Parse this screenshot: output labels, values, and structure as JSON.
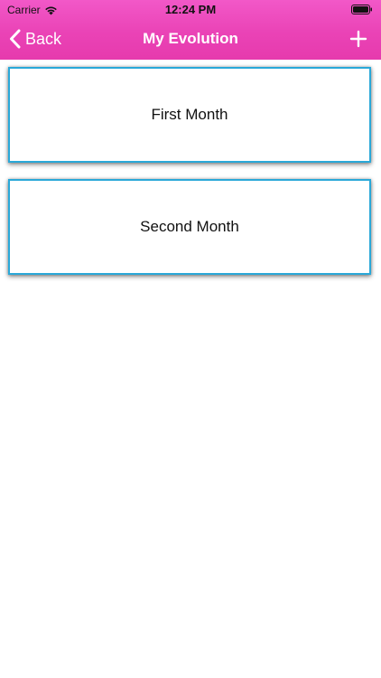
{
  "status_bar": {
    "carrier": "Carrier",
    "time": "12:24 PM"
  },
  "nav": {
    "back_label": "Back",
    "title": "My Evolution",
    "add_icon": "plus-icon"
  },
  "months": [
    {
      "label": "First Month"
    },
    {
      "label": "Second Month"
    }
  ],
  "colors": {
    "header": "#ea43b6",
    "card_border": "#2aa8d8",
    "header_text": "#ffffff"
  }
}
